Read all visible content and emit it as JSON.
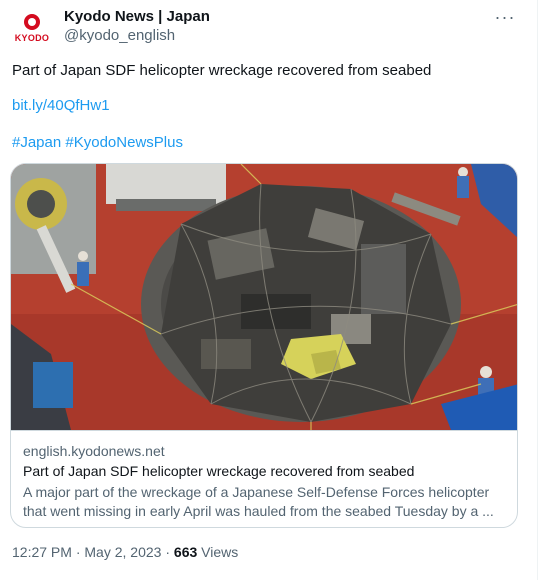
{
  "author": {
    "display_name": "Kyodo News | Japan",
    "handle": "@kyodo_english",
    "avatar_brand": "KYODO",
    "brand_color": "#d40b1f"
  },
  "more_icon": "more-horizontal-icon",
  "tweet": {
    "text": "Part of Japan SDF helicopter wreckage recovered from seabed",
    "link": "bit.ly/40QfHw1",
    "hashtags": [
      "#Japan",
      "#KyodoNewsPlus"
    ]
  },
  "card": {
    "domain": "english.kyodonews.net",
    "title": "Part of Japan SDF helicopter wreckage recovered from seabed",
    "description": "A major part of the wreckage of a Japanese Self-Defense Forces helicopter that went missing in early April was hauled from the seabed Tuesday by a ..."
  },
  "meta": {
    "time": "12:27 PM",
    "separator": "·",
    "date": "May 2, 2023",
    "views_count": "663",
    "views_label": "Views"
  },
  "colors": {
    "link": "#1d9bf0",
    "text": "#0f1419",
    "secondary": "#536471",
    "border": "#cfd9de",
    "deck": "#b5402f"
  }
}
